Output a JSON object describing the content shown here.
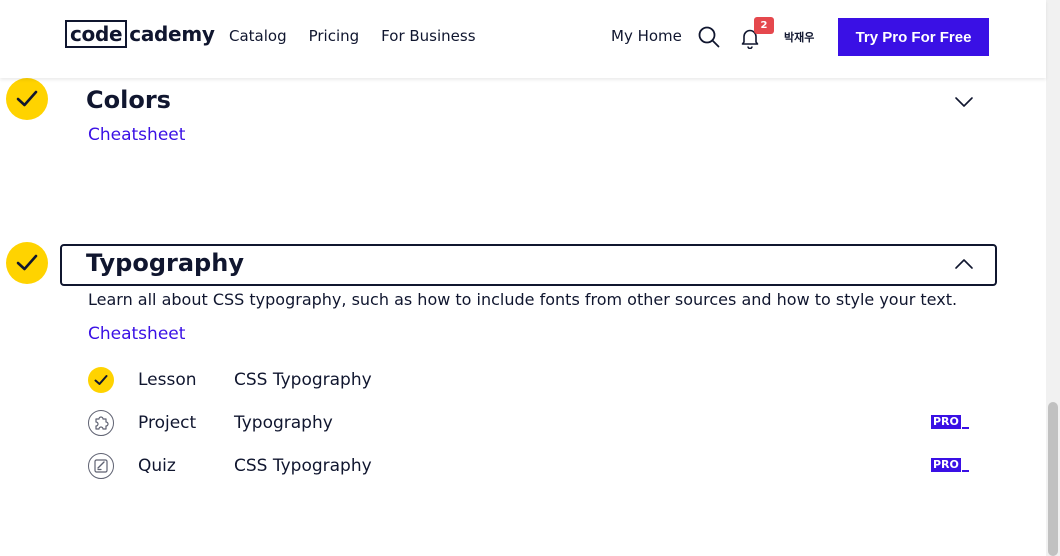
{
  "header": {
    "logo_boxed": "code",
    "logo_rest": "cademy",
    "nav": [
      "Catalog",
      "Pricing",
      "For Business"
    ],
    "my_home": "My Home",
    "notification_count": "2",
    "username": "박재우",
    "cta": "Try Pro For Free"
  },
  "modules": {
    "colors": {
      "title": "Colors",
      "cheatsheet": "Cheatsheet",
      "state": "collapsed",
      "completed": true
    },
    "typography": {
      "title": "Typography",
      "description": "Learn all about CSS typography, such as how to include fonts from other sources and how to style your text.",
      "cheatsheet": "Cheatsheet",
      "state": "expanded",
      "completed": true,
      "items": [
        {
          "type": "Lesson",
          "name": "CSS Typography",
          "icon": "completed-check-icon",
          "pro": false
        },
        {
          "type": "Project",
          "name": "Typography",
          "icon": "puzzle-icon",
          "pro": true,
          "pro_label": "PRO"
        },
        {
          "type": "Quiz",
          "name": "CSS Typography",
          "icon": "quiz-icon",
          "pro": true,
          "pro_label": "PRO"
        }
      ]
    }
  },
  "colors": {
    "brand": "#3a10e5",
    "check": "#ffd300",
    "text": "#10162f",
    "badge": "#e5484d"
  }
}
